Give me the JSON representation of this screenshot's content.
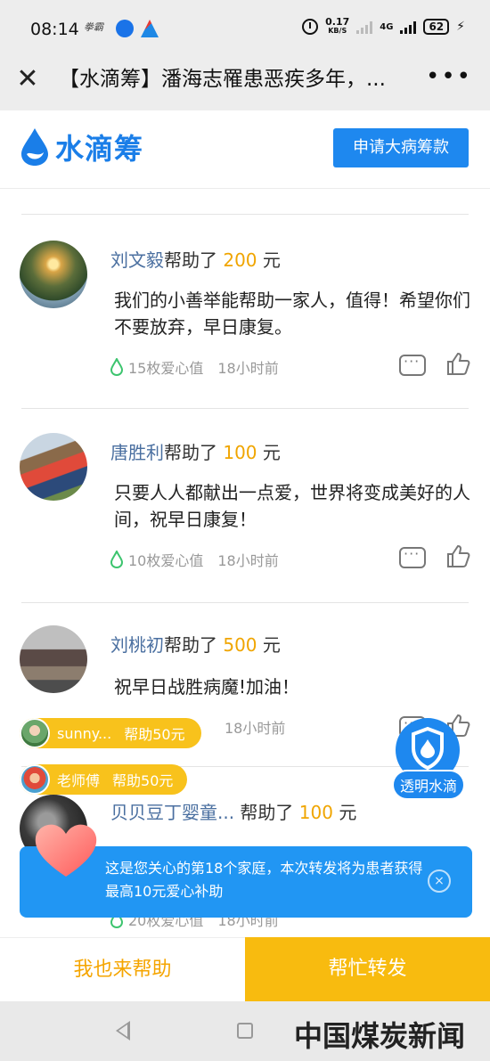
{
  "status": {
    "time": "08:14",
    "app_label": "拳霸",
    "net_speed_value": "0.17",
    "net_speed_unit": "KB/S",
    "network_type": "4G",
    "battery": "62"
  },
  "titlebar": {
    "title": "【水滴筹】潘海志罹患恶疾多年，..."
  },
  "header": {
    "logo_text": "水滴筹",
    "apply_button": "申请大病筹款"
  },
  "comments": [
    {
      "name": "刘文毅",
      "action": "帮助了 ",
      "amount": "200",
      "unit": " 元",
      "text": "我们的小善举能帮助一家人，值得！希望你们不要放弃，早日康复。",
      "love": "15枚爱心值",
      "time": "18小时前"
    },
    {
      "name": "唐胜利",
      "action": "帮助了 ",
      "amount": "100",
      "unit": " 元",
      "text": "只要人人都献出一点爱，世界将变成美好的人间，祝早日康复！",
      "love": "10枚爱心值",
      "time": "18小时前"
    },
    {
      "name": "刘桃初",
      "action": "帮助了 ",
      "amount": "500",
      "unit": " 元",
      "text": "祝早日战胜病魔!加油！",
      "love": "",
      "time": "18小时前"
    },
    {
      "name": "贝贝豆丁婴童...",
      "action": " 帮助了 ",
      "amount": "100",
      "unit": " 元",
      "text": "",
      "love": "20枚爱心值",
      "time": "18小时前"
    }
  ],
  "chips": [
    {
      "name": "sunny...",
      "label": "帮助50元"
    },
    {
      "name": "老师傅",
      "label": "帮助50元"
    }
  ],
  "badge": {
    "label": "透明水滴"
  },
  "toast": {
    "text": "这是您关心的第18个家庭，本次转发将为患者获得最高10元爱心补助",
    "close": "×"
  },
  "bottom": {
    "help": "我也来帮助",
    "share": "帮忙转发"
  },
  "watermark": "中国煤炭新闻网",
  "colors": {
    "brand_blue": "#1e88ef",
    "amount_orange": "#f0a500",
    "share_yellow": "#f8bb0f",
    "name_blue": "#4a6fa0"
  }
}
